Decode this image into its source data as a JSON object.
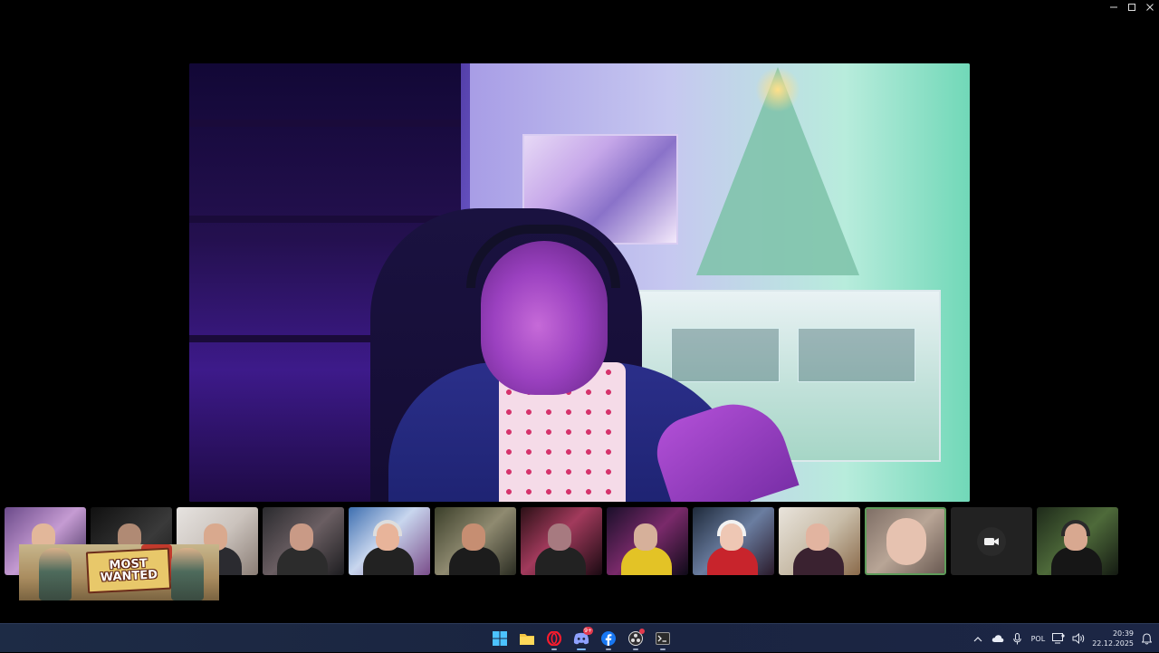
{
  "window": {
    "controls": [
      "minimize-icon",
      "maximize-icon",
      "close-icon"
    ]
  },
  "main_video": {
    "speaker_content": "streamer video feed"
  },
  "participants": {
    "tiles": [
      {
        "state": "video"
      },
      {
        "state": "video"
      },
      {
        "state": "video"
      },
      {
        "state": "video"
      },
      {
        "state": "video"
      },
      {
        "state": "video"
      },
      {
        "state": "video"
      },
      {
        "state": "video"
      },
      {
        "state": "video"
      },
      {
        "state": "video"
      },
      {
        "state": "video-active"
      },
      {
        "state": "camera-off",
        "icon": "camera-icon"
      },
      {
        "state": "video"
      }
    ]
  },
  "overlay": {
    "line1": "MOST",
    "line2": "WANTED"
  },
  "taskbar": {
    "apps": [
      {
        "name": "start",
        "icon": "windows-start-icon"
      },
      {
        "name": "file-explorer",
        "icon": "folder-icon"
      },
      {
        "name": "opera-browser",
        "icon": "opera-icon"
      },
      {
        "name": "discord",
        "icon": "discord-icon",
        "badge": "9+"
      },
      {
        "name": "facebook",
        "icon": "facebook-icon"
      },
      {
        "name": "obs",
        "icon": "obs-icon"
      },
      {
        "name": "terminal",
        "icon": "terminal-icon"
      }
    ],
    "tray": {
      "language": "POL",
      "time": "20:39",
      "date": "22.12.2025"
    },
    "colors": {
      "accent": "#7ab6ff",
      "badge": "#e33a4d",
      "active_tile_border": "#5e9c5a"
    }
  }
}
